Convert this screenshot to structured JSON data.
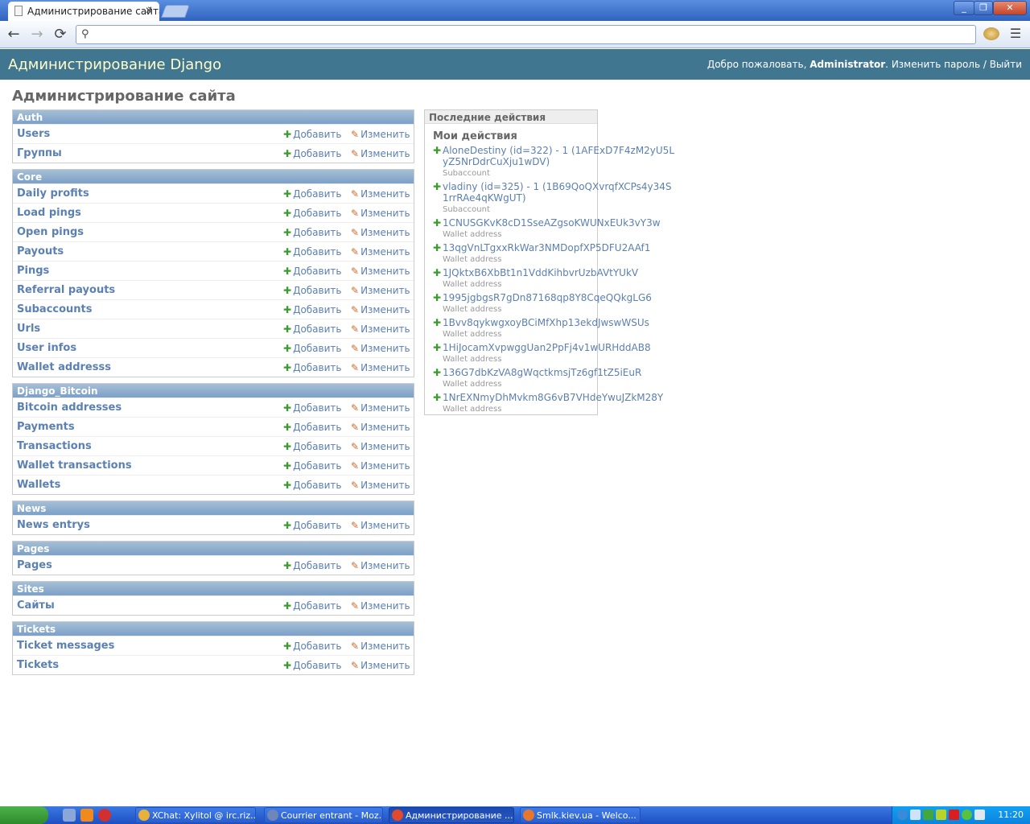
{
  "browser": {
    "tab_title": "Администрирование сайта",
    "tab_close": "✕",
    "url": "",
    "win_min": "_",
    "win_max": "❐",
    "win_close": "✕",
    "back": "←",
    "forward": "→",
    "reload": "⟳",
    "search_glyph": "⚲",
    "menu_glyph": "☰"
  },
  "header": {
    "site_name": "Администрирование Django",
    "welcome": "Добро пожаловать, ",
    "user": "Administrator",
    "dot": ". ",
    "change_password": "Изменить пароль",
    "sep": " / ",
    "logout": "Выйти"
  },
  "page_title": "Администрирование сайта",
  "labels": {
    "add": "Добавить",
    "change": "Изменить"
  },
  "apps": [
    {
      "name": "Auth",
      "models": [
        "Users",
        "Группы"
      ]
    },
    {
      "name": "Core",
      "models": [
        "Daily profits",
        "Load pings",
        "Open pings",
        "Payouts",
        "Pings",
        "Referral payouts",
        "Subaccounts",
        "Urls",
        "User infos",
        "Wallet addresss"
      ]
    },
    {
      "name": "Django_Bitcoin",
      "models": [
        "Bitcoin addresses",
        "Payments",
        "Transactions",
        "Wallet transactions",
        "Wallets"
      ]
    },
    {
      "name": "News",
      "models": [
        "News entrys"
      ]
    },
    {
      "name": "Pages",
      "models": [
        "Pages"
      ]
    },
    {
      "name": "Sites",
      "models": [
        "Сайты"
      ]
    },
    {
      "name": "Tickets",
      "models": [
        "Ticket messages",
        "Tickets"
      ]
    }
  ],
  "recent": {
    "caption": "Последние действия",
    "my_actions": "Мои действия",
    "items": [
      {
        "text": "AloneDestiny (id=322) - 1 (1AFExD7F4zM2yU5LyZ5NrDdrCuXju1wDV)",
        "type": "Subaccount"
      },
      {
        "text": "vladiny (id=325) - 1 (1B69QoQXvrqfXCPs4y34S1rrRAe4qKWgUT)",
        "type": "Subaccount"
      },
      {
        "text": "1CNUSGKvK8cD1SseAZgsoKWUNxEUk3vY3w",
        "type": "Wallet address"
      },
      {
        "text": "13qgVnLTgxxRkWar3NMDopfXP5DFU2AAf1",
        "type": "Wallet address"
      },
      {
        "text": "1JQktxB6XbBt1n1VddKihbvrUzbAVtYUkV",
        "type": "Wallet address"
      },
      {
        "text": "1995jgbgsR7gDn87168qp8Y8CqeQQkgLG6",
        "type": "Wallet address"
      },
      {
        "text": "1Bvv8qykwgxoyBCiMfXhp13ekdJwswWSUs",
        "type": "Wallet address"
      },
      {
        "text": "1HiJocamXvpwggUan2PpFj4v1wURHddAB8",
        "type": "Wallet address"
      },
      {
        "text": "136G7dbKzVA8gWqctkmsjTz6gf1tZ5iEuR",
        "type": "Wallet address"
      },
      {
        "text": "1NrEXNmyDhMvkm8G6vB7VHdeYwuJZkM28Y",
        "type": "Wallet address"
      }
    ]
  },
  "taskbar": {
    "tasks": [
      {
        "label": "XChat: Xylitol @ irc.riz...",
        "icon_color": "#e8b23a"
      },
      {
        "label": "Courrier entrant - Moz...",
        "icon_color": "#6f86b8"
      },
      {
        "label": "Администрирование ...",
        "icon_color": "#e24a2b"
      },
      {
        "label": "Smlk.kiev.ua - Welco...",
        "icon_color": "#e8772b"
      }
    ],
    "clock": "11:20"
  }
}
